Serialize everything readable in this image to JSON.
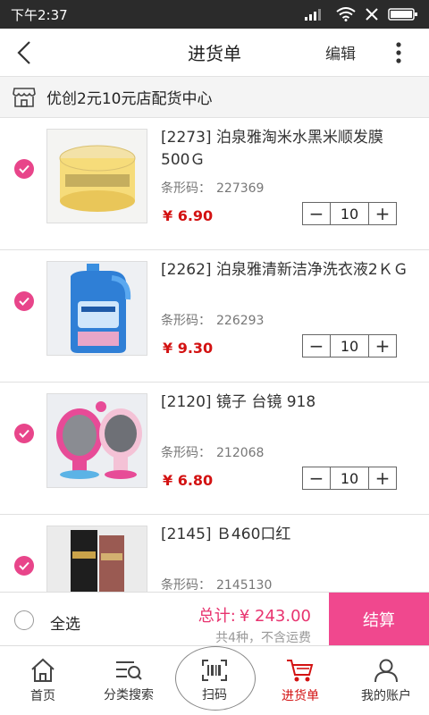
{
  "status_bar": {
    "time": "下午2:37"
  },
  "header": {
    "title": "进货单",
    "edit_label": "编辑"
  },
  "store": {
    "name": "优创2元10元店配货中心"
  },
  "items": [
    {
      "name": "[2273] 泊泉雅淘米水黑米顺发膜500Ｇ",
      "barcode_label": "条形码：",
      "barcode": "227369",
      "price": "¥ 6.90",
      "qty": "10",
      "checked": true
    },
    {
      "name": "[2262] 泊泉雅清新洁净洗衣液2ＫＧ",
      "barcode_label": "条形码：",
      "barcode": "226293",
      "price": "¥ 9.30",
      "qty": "10",
      "checked": true
    },
    {
      "name": "[2120] 镜子 台镜 918",
      "barcode_label": "条形码：",
      "barcode": "212068",
      "price": "¥ 6.80",
      "qty": "10",
      "checked": true
    },
    {
      "name": "[2145] Ｂ460口红",
      "barcode_label": "条形码：",
      "barcode": "2145130",
      "price": "",
      "qty": "",
      "checked": true
    }
  ],
  "footer": {
    "select_all_label": "全选",
    "total_label": "总计:",
    "total_value": "¥ 243.00",
    "summary": "共4种，不含运费",
    "checkout_label": "结算"
  },
  "tabs": [
    {
      "label": "首页",
      "icon": "home-icon"
    },
    {
      "label": "分类搜索",
      "icon": "category-search-icon"
    },
    {
      "label": "扫码",
      "icon": "scan-barcode-icon"
    },
    {
      "label": "进货单",
      "icon": "cart-icon",
      "active": true
    },
    {
      "label": "我的账户",
      "icon": "user-icon"
    }
  ],
  "colors": {
    "accent": "#f0488e",
    "price": "#d31212",
    "check": "#e8458a"
  }
}
